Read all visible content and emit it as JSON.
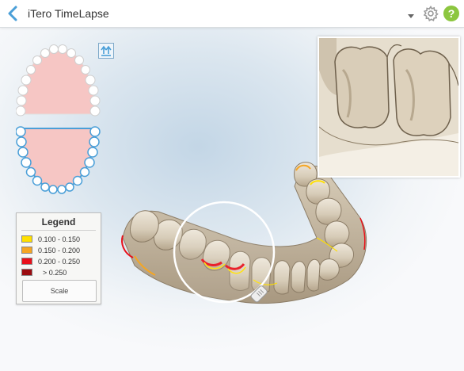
{
  "header": {
    "title": "iTero TimeLapse",
    "back_icon": "chevron-left-icon",
    "menu_icon": "caret-down-icon",
    "settings_icon": "gear-icon",
    "help_label": "?"
  },
  "colors": {
    "accent": "#4a9fd8",
    "help_green": "#8cc63f",
    "gum_pink": "#f6c6c4",
    "tooth_beige": "#d9cfbd"
  },
  "jaw_selector": {
    "upper": "upper-jaw",
    "lower": "lower-jaw",
    "selected": "lower-jaw",
    "switch_icon": "swap-jaws-icon"
  },
  "legend": {
    "title": "Legend",
    "items": [
      {
        "label": "0.100 - 0.150",
        "color": "#ffe000"
      },
      {
        "label": "0.150 - 0.200",
        "color": "#f5a623"
      },
      {
        "label": "0.200 - 0.250",
        "color": "#e8101b"
      },
      {
        "label": "> 0.250",
        "color": "#9b0c10"
      }
    ],
    "scale_button": "Scale"
  },
  "viewer": {
    "magnifier_icon": "magnifier-handle-icon",
    "zoom_view": "magnified-detail-view"
  }
}
